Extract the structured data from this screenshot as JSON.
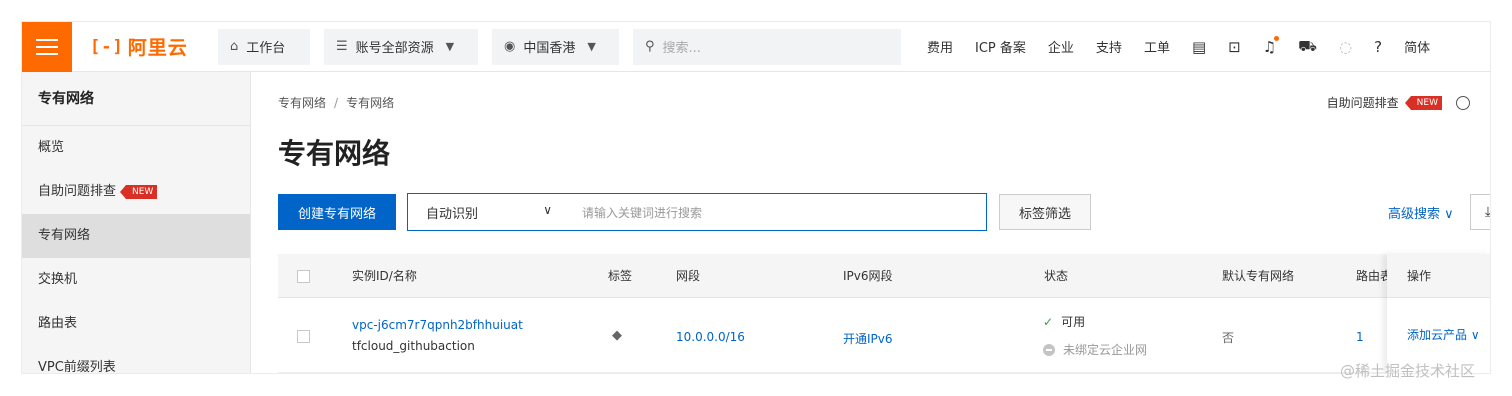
{
  "topbar": {
    "logo_mark": "[-]",
    "logo_text": "阿里云",
    "workbench": "工作台",
    "resources": "账号全部资源",
    "region": "中国香港",
    "search_placeholder": "搜索...",
    "links": [
      "费用",
      "ICP 备案",
      "企业",
      "支持",
      "工单"
    ],
    "lang": "简体"
  },
  "sidebar": {
    "title": "专有网络",
    "items": [
      {
        "label": "概览"
      },
      {
        "label": "自助问题排查",
        "badge": "NEW"
      },
      {
        "label": "专有网络"
      },
      {
        "label": "交换机"
      },
      {
        "label": "路由表"
      },
      {
        "label": "VPC前缀列表"
      }
    ],
    "active_index": 2
  },
  "main": {
    "breadcrumb": [
      "专有网络",
      "专有网络"
    ],
    "breadcrumb_sep": "/",
    "helper": "自助问题排查",
    "helper_badge": "NEW",
    "title": "专有网络",
    "create_button": "创建专有网络",
    "filter_select": "自动识别",
    "filter_placeholder": "请输入关键词进行搜索",
    "tag_filter_button": "标签筛选",
    "advanced_search": "高级搜索"
  },
  "table": {
    "headers": {
      "instance": "实例ID/名称",
      "tags": "标签",
      "cidr": "网段",
      "ipv6": "IPv6网段",
      "status": "状态",
      "default_vpc": "默认专有网络",
      "route": "路由表",
      "actions": "操作"
    },
    "rows": [
      {
        "id": "vpc-j6cm7r7qpnh2bfhhuiuat",
        "name": "tfcloud_githubaction",
        "cidr": "10.0.0.0/16",
        "ipv6": "开通IPv6",
        "status": "可用",
        "cen_status": "未绑定云企业网",
        "default": "否",
        "route_count": "1",
        "action": "添加云产品"
      }
    ]
  },
  "watermark": "@稀土掘金技术社区",
  "colors": {
    "brand": "#ff6a00",
    "link": "#0064c8",
    "badge": "#d93026",
    "success": "#2ea34a"
  }
}
